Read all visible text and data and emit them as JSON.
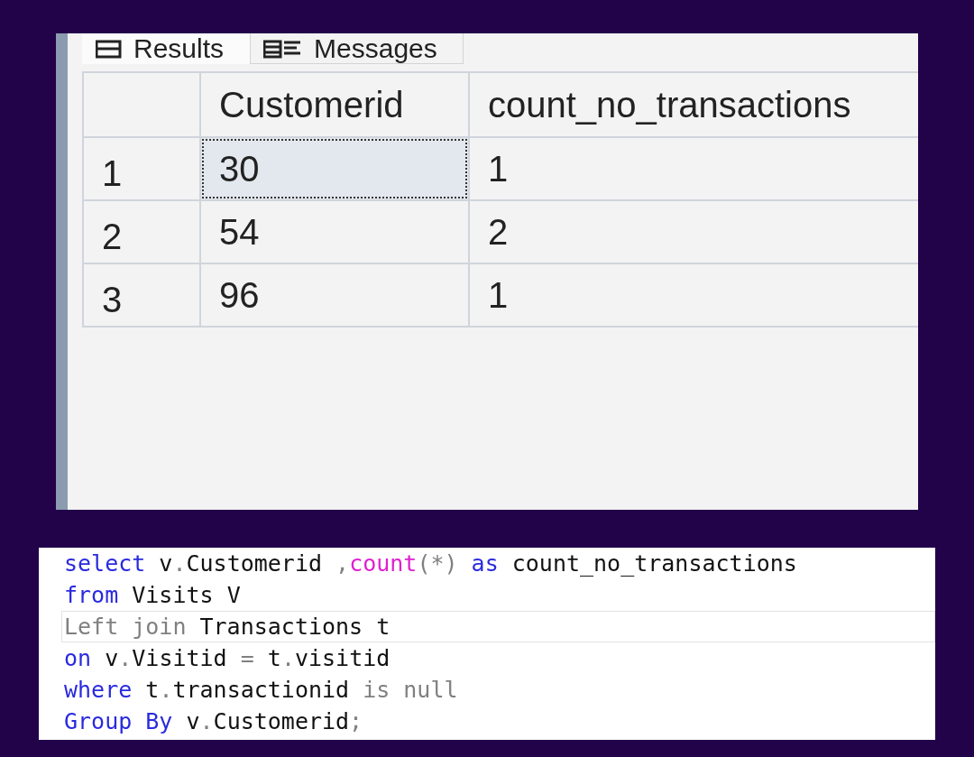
{
  "results_panel": {
    "tabs": [
      {
        "label": "Results",
        "selected": true
      },
      {
        "label": "Messages",
        "selected": false
      }
    ],
    "grid": {
      "columns": [
        "Customerid",
        "count_no_transactions"
      ],
      "rows": [
        {
          "number": "1",
          "cells": [
            {
              "text": "30",
              "focused": true
            },
            {
              "text": "1",
              "focused": false
            }
          ]
        },
        {
          "number": "2",
          "cells": [
            {
              "text": "54",
              "focused": false
            },
            {
              "text": "2",
              "focused": false
            }
          ]
        },
        {
          "number": "3",
          "cells": [
            {
              "text": "96",
              "focused": false
            },
            {
              "text": "1",
              "focused": false
            }
          ]
        }
      ]
    }
  },
  "editor": {
    "lines": [
      {
        "current": false,
        "tokens": [
          {
            "text": "select",
            "kind": "keyword"
          },
          {
            "text": " v",
            "kind": "plain"
          },
          {
            "text": ".",
            "kind": "operator"
          },
          {
            "text": "Customerid ",
            "kind": "plain"
          },
          {
            "text": ",",
            "kind": "operator"
          },
          {
            "text": "count",
            "kind": "function"
          },
          {
            "text": "(*)",
            "kind": "operator"
          },
          {
            "text": " as",
            "kind": "keyword"
          },
          {
            "text": " count_no_transactions",
            "kind": "plain"
          }
        ]
      },
      {
        "current": false,
        "tokens": [
          {
            "text": "from",
            "kind": "keyword"
          },
          {
            "text": " Visits V",
            "kind": "plain"
          }
        ]
      },
      {
        "current": true,
        "tokens": [
          {
            "text": "Left join",
            "kind": "operator"
          },
          {
            "text": " Transactions t",
            "kind": "plain"
          }
        ]
      },
      {
        "current": false,
        "tokens": [
          {
            "text": "on",
            "kind": "keyword"
          },
          {
            "text": " v",
            "kind": "plain"
          },
          {
            "text": ".",
            "kind": "operator"
          },
          {
            "text": "Visitid ",
            "kind": "plain"
          },
          {
            "text": "=",
            "kind": "operator"
          },
          {
            "text": " t",
            "kind": "plain"
          },
          {
            "text": ".",
            "kind": "operator"
          },
          {
            "text": "visitid",
            "kind": "plain"
          }
        ]
      },
      {
        "current": false,
        "tokens": [
          {
            "text": "where",
            "kind": "keyword"
          },
          {
            "text": " t",
            "kind": "plain"
          },
          {
            "text": ".",
            "kind": "operator"
          },
          {
            "text": "transactionid ",
            "kind": "plain"
          },
          {
            "text": "is null",
            "kind": "operator"
          }
        ]
      },
      {
        "current": false,
        "tokens": [
          {
            "text": "Group By",
            "kind": "keyword"
          },
          {
            "text": " v",
            "kind": "plain"
          },
          {
            "text": ".",
            "kind": "operator"
          },
          {
            "text": "Customerid",
            "kind": "plain"
          },
          {
            "text": ";",
            "kind": "operator"
          }
        ]
      }
    ]
  }
}
